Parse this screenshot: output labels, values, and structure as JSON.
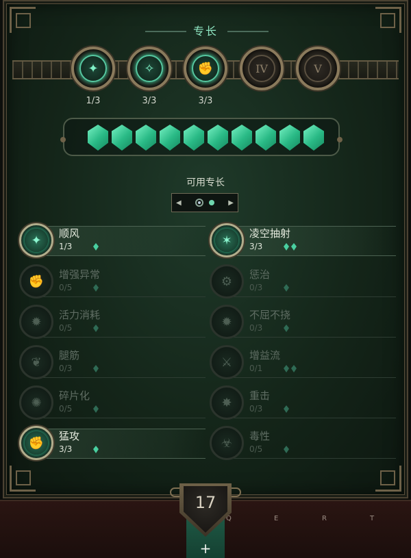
{
  "header": {
    "title": "专长"
  },
  "tiers": [
    {
      "label": "",
      "count": "1/3",
      "icon": "glyph-wind-icon",
      "unlocked": true
    },
    {
      "label": "",
      "count": "3/3",
      "icon": "glyph-shatter-icon",
      "unlocked": true
    },
    {
      "label": "",
      "count": "3/3",
      "icon": "glyph-fist-icon",
      "unlocked": true
    },
    {
      "label": "IV",
      "count": "",
      "icon": "roman-four-icon",
      "unlocked": false
    },
    {
      "label": "V",
      "count": "",
      "icon": "roman-five-icon",
      "unlocked": false
    }
  ],
  "points": {
    "available_gems": 10
  },
  "section": {
    "available_label": "可用专长"
  },
  "pager": {
    "left_arrow": "◀",
    "right_arrow": "▶",
    "page": 1,
    "pages": 2
  },
  "skills_left": [
    {
      "name": "顺风",
      "rank": "1/3",
      "cost": 1,
      "active": true,
      "icon": "wind-icon"
    },
    {
      "name": "增强异常",
      "rank": "0/5",
      "cost": 1,
      "active": false,
      "icon": "fist-plus-icon"
    },
    {
      "name": "活力消耗",
      "rank": "0/5",
      "cost": 1,
      "active": false,
      "icon": "compass-icon"
    },
    {
      "name": "腿筋",
      "rank": "0/3",
      "cost": 1,
      "active": false,
      "icon": "wing-icon"
    },
    {
      "name": "碎片化",
      "rank": "0/5",
      "cost": 1,
      "active": false,
      "icon": "shard-icon"
    },
    {
      "name": "猛攻",
      "rank": "3/3",
      "cost": 1,
      "active": true,
      "icon": "fist-plus-icon"
    }
  ],
  "skills_right": [
    {
      "name": "凌空抽射",
      "rank": "3/3",
      "cost": 2,
      "active": true,
      "icon": "burst-icon"
    },
    {
      "name": "惩治",
      "rank": "0/3",
      "cost": 1,
      "active": false,
      "icon": "gear-icon"
    },
    {
      "name": "不屈不挠",
      "rank": "0/3",
      "cost": 1,
      "active": false,
      "icon": "compass-icon"
    },
    {
      "name": "增益流",
      "rank": "0/1",
      "cost": 2,
      "active": false,
      "icon": "sword-stream-icon"
    },
    {
      "name": "重击",
      "rank": "0/3",
      "cost": 1,
      "active": false,
      "icon": "strike-icon"
    },
    {
      "name": "毒性",
      "rank": "0/5",
      "cost": 1,
      "active": false,
      "icon": "poison-icon"
    }
  ],
  "footer": {
    "level": "17",
    "hotkeys": [
      "Q",
      "E",
      "R",
      "T"
    ],
    "add_symbol": "+"
  },
  "colors": {
    "accent": "#49cfa0",
    "frame": "#6e6148",
    "panel": "#142519"
  }
}
